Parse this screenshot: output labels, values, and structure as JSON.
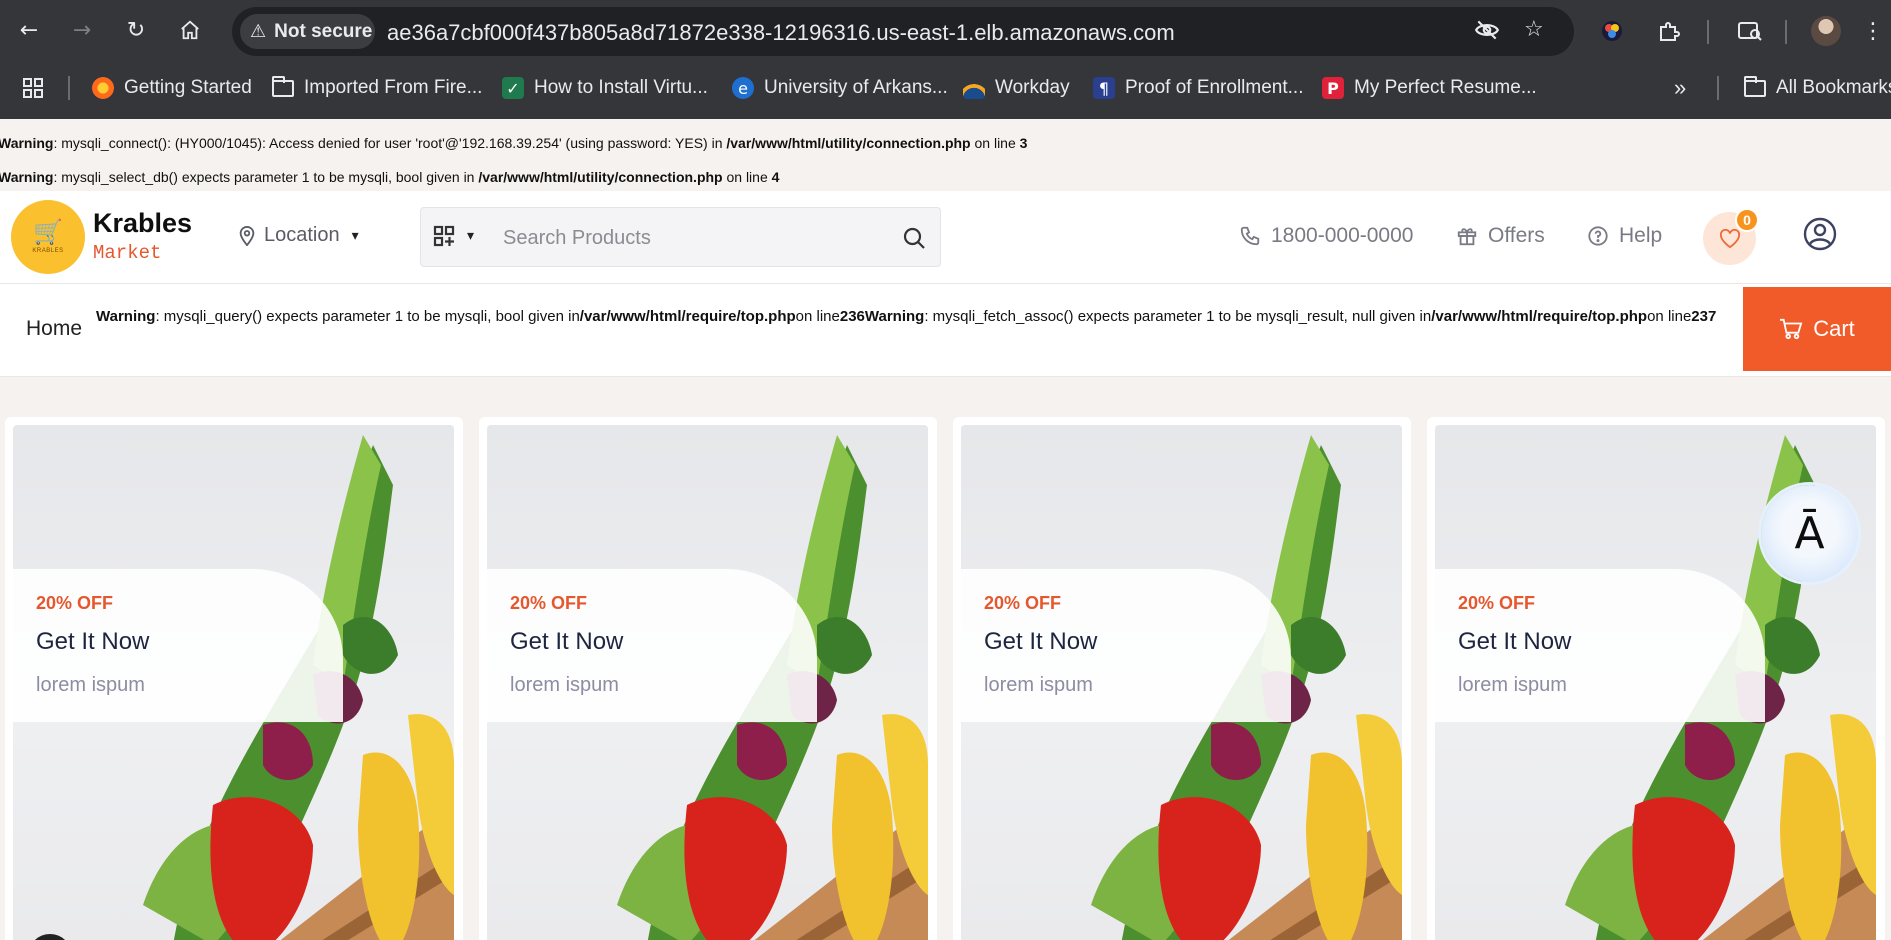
{
  "browser": {
    "not_secure_label": "Not secure",
    "url": "ae36a7cbf000f437b805a8d71872e338-12196316.us-east-1.elb.amazonaws.com",
    "bookmarks": [
      {
        "label": "Getting Started",
        "icon": "firefox-icon"
      },
      {
        "label": "Imported From Fire...",
        "icon": "folder-icon"
      },
      {
        "label": "How to Install Virtu...",
        "icon": "shield-icon"
      },
      {
        "label": "University of Arkans...",
        "icon": "globe-icon"
      },
      {
        "label": "Workday",
        "icon": "workday-icon"
      },
      {
        "label": "Proof of Enrollment...",
        "icon": "document-icon"
      },
      {
        "label": "My Perfect Resume...",
        "icon": "resume-icon"
      }
    ],
    "overflow_label": "»",
    "all_bookmarks_label": "All Bookmarks"
  },
  "warnings": {
    "w1": {
      "prefix": "Warning",
      "text": ": mysqli_connect(): (HY000/1045): Access denied for user 'root'@'192.168.39.254' (using password: YES) in ",
      "path": "/var/www/html/utility/connection.php",
      "mid": " on line ",
      "line": "3"
    },
    "w2": {
      "prefix": "Warning",
      "text": ": mysqli_select_db() expects parameter 1 to be mysqli, bool given in ",
      "path": "/var/www/html/utility/connection.php",
      "mid": " on line ",
      "line": "4"
    },
    "w3": {
      "prefix": "Warning",
      "text": ": mysqli_query() expects parameter 1 to be mysqli, bool given in",
      "path": "/var/www/html/require/top.php",
      "mid": "on line",
      "line": "236"
    },
    "w4": {
      "prefix": "Warning",
      "text": ": mysqli_fetch_assoc() expects parameter 1 to be mysqli_result, null given in",
      "path": "/var/www/html/require/top.php",
      "mid": "on line",
      "line": "237"
    }
  },
  "header": {
    "logo_text": "KRABLES",
    "brand_name": "Krables",
    "brand_sub": "Market",
    "location_label": "Location",
    "search_placeholder": "Search Products",
    "phone": "1800-000-0000",
    "offers_label": "Offers",
    "help_label": "Help",
    "wishlist_count": "0"
  },
  "breadcrumb": {
    "home_label": "Home",
    "cart_label": "Cart"
  },
  "promos": [
    {
      "discount": "20% OFF",
      "title": "Get It Now",
      "subtitle": "lorem ispum"
    },
    {
      "discount": "20% OFF",
      "title": "Get It Now",
      "subtitle": "lorem ispum"
    },
    {
      "discount": "20% OFF",
      "title": "Get It Now",
      "subtitle": "lorem ispum"
    },
    {
      "discount": "20% OFF",
      "title": "Get It Now",
      "subtitle": "lorem ispum"
    }
  ],
  "floating_badge": "Ā",
  "colors": {
    "accent": "#f15a29",
    "chrome": "#35363a",
    "logo": "#fbc02d"
  }
}
